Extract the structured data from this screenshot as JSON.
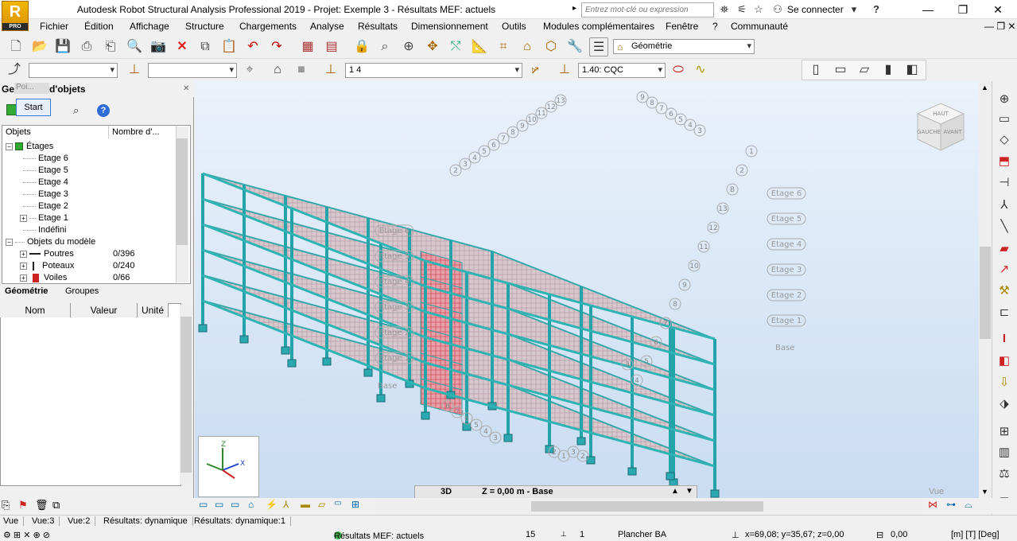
{
  "app": {
    "logo": "R",
    "logo_sub": "PRO",
    "title": "Autodesk Robot Structural Analysis Professional 2019 - Projet: Exemple 3 - Résultats MEF: actuels",
    "search_placeholder": "Entrez mot-clé ou expression",
    "signin": "Se connecter"
  },
  "menu": [
    "Fichier",
    "Édition",
    "Affichage",
    "Structure",
    "Chargements",
    "Analyse",
    "Résultats",
    "Dimensionnement",
    "Outils",
    "Modules complémentaires",
    "Fenêtre",
    "?",
    "Communauté"
  ],
  "toolbar": {
    "geometry_combo": "Géométrie",
    "case_combo": "1 4",
    "mode_combo": "1.40: CQC"
  },
  "object_inspector": {
    "title": "Gestionnaire d'objets",
    "title_prefix": "Ge",
    "title_suffix": "d'objets",
    "tooltip_start": "Start",
    "tooltip_poi": "Poi...",
    "col_objects": "Objets",
    "col_count": "Nombre d'...",
    "tree": [
      {
        "label": "Étages",
        "level": 0,
        "expander": "⊟"
      },
      {
        "label": "Etage 6",
        "level": 1
      },
      {
        "label": "Etage 5",
        "level": 1
      },
      {
        "label": "Etage 4",
        "level": 1
      },
      {
        "label": "Etage 3",
        "level": 1
      },
      {
        "label": "Etage 2",
        "level": 1
      },
      {
        "label": "Etage 1",
        "level": 1,
        "expander": "⊞"
      },
      {
        "label": "Indéfini",
        "level": 1
      },
      {
        "label": "Objets du modèle",
        "level": 0,
        "expander": "⊟"
      },
      {
        "label": "Poutres",
        "level": 1,
        "expander": "⊞",
        "count": "0/396"
      },
      {
        "label": "Poteaux",
        "level": 1,
        "expander": "⊞",
        "count": "0/240"
      },
      {
        "label": "Voiles",
        "level": 1,
        "expander": "⊞",
        "count": "0/66"
      }
    ],
    "tabs": [
      "Géométrie",
      "Groupes"
    ]
  },
  "properties": {
    "col_name": "Nom",
    "col_value": "Valeur",
    "col_unit": "Unité"
  },
  "viewport": {
    "view_label": "3D",
    "z_label": "Z = 0,00 m - Base",
    "vue": "Vue",
    "viewcube_top": "HAUT",
    "viewcube_left": "GAUCHE",
    "viewcube_right": "AVANT",
    "etage_right": [
      "Etage 6",
      "Etage 5",
      "Etage 4",
      "Etage 3",
      "Etage 2",
      "Etage 1"
    ],
    "etage_left": [
      "Etage 6",
      "Etage 5",
      "Etage 4",
      "Etage 3",
      "Etage 2",
      "Etage 1"
    ],
    "axis_top_left": [
      "13",
      "12",
      "11",
      "10",
      "9",
      "8",
      "7",
      "6",
      "5",
      "4",
      "3",
      "2"
    ],
    "axis_top_right": [
      "9",
      "8",
      "7",
      "6",
      "5",
      "4",
      "3"
    ],
    "axis_right": [
      "1",
      "2",
      "B",
      "13",
      "12",
      "11",
      "10",
      "9",
      "8",
      "7",
      "6",
      "5",
      "4",
      "3"
    ],
    "axis_bottom_left": [
      "8",
      "7",
      "6",
      "5",
      "4",
      "3"
    ],
    "axis_bottom": [
      "2",
      "1",
      "3",
      "2"
    ],
    "axis_bottom_left_label": "Base",
    "axis_right_label": "Base"
  },
  "bottom_tabs": [
    "Vue",
    "Vue:3",
    "Vue:2",
    "Résultats: dynamique",
    "Résultats: dynamique:1"
  ],
  "status": {
    "results": "Résultats MEF: actuels",
    "num1": "15",
    "num2": "1",
    "material": "Plancher BA",
    "coords": "x=69,08; y=35,67; z=0,00",
    "value": "0,00",
    "units": "[m] [T] [Deg]"
  }
}
